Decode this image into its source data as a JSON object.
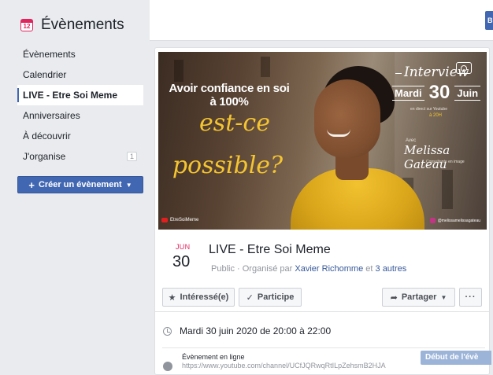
{
  "sidebar": {
    "title": "Évènements",
    "calendar_icon_day": "12",
    "items": [
      {
        "label": "Évènements"
      },
      {
        "label": "Calendrier"
      },
      {
        "label": "LIVE - Etre Soi Meme"
      },
      {
        "label": "Anniversaires"
      },
      {
        "label": "À découvrir"
      },
      {
        "label": "J'organise",
        "count": "1"
      }
    ],
    "create_button": "Créer un évènement"
  },
  "topbar": {
    "button_label": "B"
  },
  "cover": {
    "headline": "Avoir confiance en soi à 100%",
    "script_line1": "est-ce",
    "script_line2": "possible?",
    "interview": "Interview",
    "day_name": "Mardi",
    "day_number": "30",
    "month": "Juin",
    "stream_note": "en direct sur Youtube",
    "time_note": "à 20H",
    "with_label": "Avec",
    "guest_name": "Melissa Gateau",
    "guest_role": "Consultante en image",
    "channel_tag": "EtreSoiMeme",
    "instagram_tag": "@melissamelissagateau"
  },
  "event": {
    "month": "JUN",
    "day": "30",
    "title": "LIVE - Etre Soi Meme",
    "visibility": "Public · Organisé par",
    "organizer": "Xavier Richomme",
    "and_text": "et",
    "others": "3 autres"
  },
  "actions": {
    "interested": "Intéressé(e)",
    "going": "Participe",
    "share": "Partager",
    "more": "···"
  },
  "details": {
    "datetime": "Mardi 30 juin 2020 de 20:00 à 22:00",
    "online_label": "Évènement en ligne",
    "online_url": "https://www.youtube.com/channel/UCfJQRwqRtILpZehsmB2HJA",
    "start_button": "Début de l'évè"
  },
  "colors": {
    "accent": "#4267b2",
    "date_red": "#e0245e",
    "cover_yellow": "#f4c531",
    "link": "#365899"
  }
}
